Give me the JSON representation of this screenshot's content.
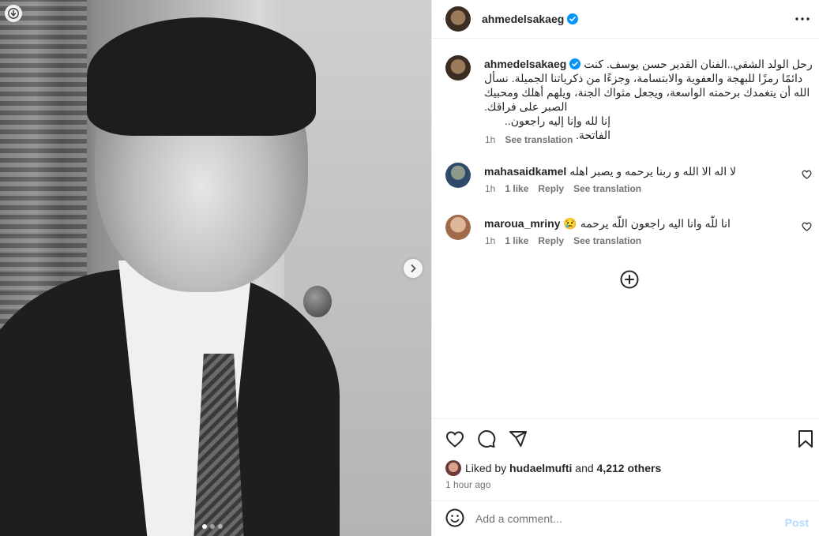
{
  "post": {
    "author": "ahmedelsakaeg",
    "caption": "رحل الولد الشقي..الفنان القدير حسن يوسف. كنت دائمًا رمزًا للبهجة والعفوية والابتسامة، وجزءًا من ذكرياتنا الجميلة. نسأل الله أن يتغمدك برحمته الواسعة، ويجعل مثواك الجنة، ويلهم أهلك ومحبيك الصبر على فراقك.",
    "caption_last": "إنا لله وإنا إليه راجعون.. الفاتحة.",
    "caption_time": "1h",
    "see_translation": "See translation"
  },
  "comments": [
    {
      "user": "mahasaidkamel",
      "text": "لا اله الا الله و ربنا يرحمه و يصبر اهله",
      "time": "1h",
      "likes": "1 like",
      "reply": "Reply",
      "translate": "See translation"
    },
    {
      "user": "maroua_mriny",
      "text": "انا للّه وانا اليه راجعون اللّه يرحمه 😢",
      "time": "1h",
      "likes": "1 like",
      "reply": "Reply",
      "translate": "See translation"
    }
  ],
  "likes": {
    "prefix": "Liked by",
    "user": "hudaelmufti",
    "and": "and",
    "others": "4,212 others"
  },
  "posted_ago": "1 hour ago",
  "composer": {
    "placeholder": "Add a comment...",
    "post_label": "Post"
  },
  "icons": {
    "download": "download-icon",
    "next": "chevron-right-icon",
    "more": "more-horizontal-icon",
    "verified": "verified-badge-icon",
    "heart": "heart-icon",
    "comment": "comment-icon",
    "share": "share-icon",
    "save": "bookmark-icon",
    "emoji": "emoji-icon",
    "load_more": "plus-circle-icon"
  },
  "colors": {
    "verified": "#0095f6",
    "post_disabled": "#b3dbff",
    "text": "#262626",
    "secondary": "#737373"
  },
  "carousel": {
    "current": 1,
    "total": 3
  }
}
